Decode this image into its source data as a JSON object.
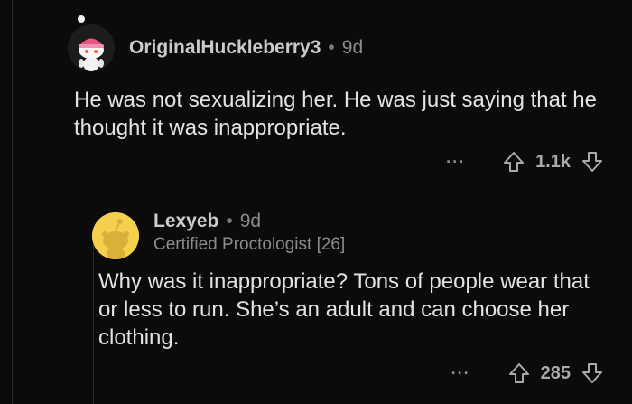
{
  "comments": [
    {
      "username": "OriginalHuckleberry3",
      "age": "9d",
      "body": "He was not sexualizing her. He was just saying that he thought it was inappropriate.",
      "votes": "1.1k",
      "more": "···",
      "avatar_icon": "snoo-avatar-pink-beanie"
    },
    {
      "username": "Lexyeb",
      "age": "9d",
      "flair": "Certified Proctologist [26]",
      "body": "Why was it inappropriate? Tons of people wear that or less to run. She’s an adult and can choose her clothing.",
      "votes": "285",
      "more": "···",
      "avatar_icon": "default-snoo-avatar-yellow"
    }
  ],
  "colors": {
    "background": "#0b0b0b",
    "text": "#e1e3e5",
    "muted": "#8a8c8e",
    "avatar2_bg": "#f5d04c"
  },
  "icons": [
    "upvote-icon",
    "downvote-icon",
    "more-options-icon"
  ]
}
